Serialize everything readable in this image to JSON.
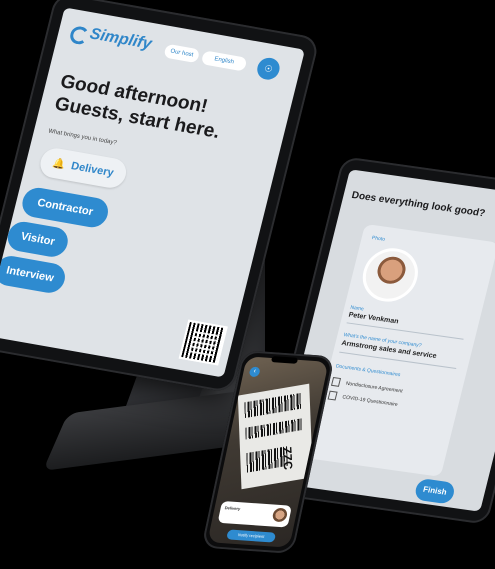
{
  "kiosk": {
    "brand": "Simplify",
    "host_pill": "Our host",
    "lang_pill": "English",
    "greeting": "Good afternoon! Guests, start here.",
    "prompt": "What brings you in today?",
    "options": {
      "delivery": "Delivery",
      "contractor": "Contractor",
      "visitor": "Visitor",
      "interview": "Interview"
    }
  },
  "review": {
    "title": "Does everything look good?",
    "photo_label": "Photo",
    "name_label": "Name",
    "name_value": "Peter Venkman",
    "company_label": "What's the name of your company?",
    "company_value": "Armstrong sales and service",
    "documents_label": "Documents & Questionnaires",
    "documents": [
      "Nondisclosure Agreement",
      "COVID-19 Questionnaire"
    ],
    "finish": "Finish"
  },
  "phone": {
    "zzc_text": "ZZC",
    "notice_title": "Delivery",
    "action_button": "Notify recipient"
  },
  "colors": {
    "accent": "#2e8bd0",
    "background": "#000000",
    "screen": "#dfe3e7"
  }
}
